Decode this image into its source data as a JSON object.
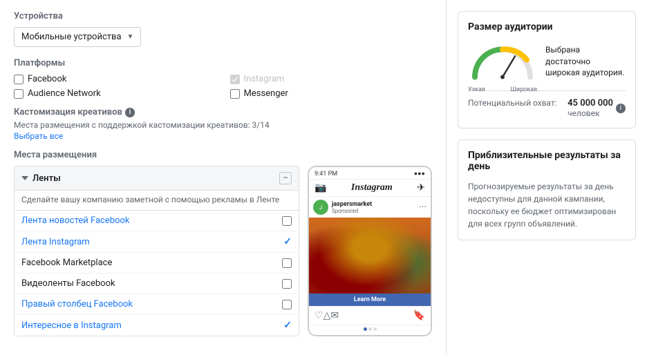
{
  "left": {
    "devices_label": "Устройства",
    "device_value": "Мобильные устройства",
    "platforms_label": "Платформы",
    "platforms": [
      {
        "id": "facebook",
        "label": "Facebook",
        "checked": false,
        "disabled": false
      },
      {
        "id": "instagram",
        "label": "Instagram",
        "checked": true,
        "disabled": true
      },
      {
        "id": "audience_network",
        "label": "Audience Network",
        "checked": false,
        "disabled": false
      },
      {
        "id": "messenger",
        "label": "Messenger",
        "checked": false,
        "disabled": false
      }
    ],
    "customization_label": "Кастомизация креативов",
    "customization_sub": "Места размещения с поддержкой кастомизации креативов: 3/14",
    "select_all": "Выбрать все",
    "placements_label": "Места размещения",
    "placement_group": {
      "title": "Ленты",
      "subtitle": "Сделайте вашу компанию заметной с помощью рекламы в Ленте",
      "items": [
        {
          "label": "Лента новостей Facebook",
          "checked": false,
          "highlighted": false
        },
        {
          "label": "Лента Instagram",
          "checked": true,
          "highlighted": true
        },
        {
          "label": "Facebook Marketplace",
          "checked": false,
          "highlighted": false
        },
        {
          "label": "Видеоленты Facebook",
          "checked": false,
          "highlighted": false
        },
        {
          "label": "Правый столбец Facebook",
          "checked": false,
          "highlighted": true
        },
        {
          "label": "Интересное в Instagram",
          "checked": true,
          "highlighted": true
        }
      ]
    }
  },
  "right": {
    "audience_title": "Размер аудитории",
    "audience_desc": "Выбрана достаточно широкая аудитория.",
    "gauge_narrow": "Узкая",
    "gauge_wide": "Широкая",
    "reach_label": "Потенциальный охват:",
    "reach_value": "45 000 000",
    "reach_unit": "человек",
    "results_title": "Приблизительные результаты за день",
    "results_desc": "Прогнозируемые результаты за день недоступны для данной кампании, поскольку ее бюджет оптимизирован для всех групп объявлений."
  },
  "phone_preview": {
    "time": "9:41 PM",
    "brand": "Instagram",
    "username": "jaspersmarket",
    "sponsored": "Sponsored",
    "cta": "Learn More"
  }
}
